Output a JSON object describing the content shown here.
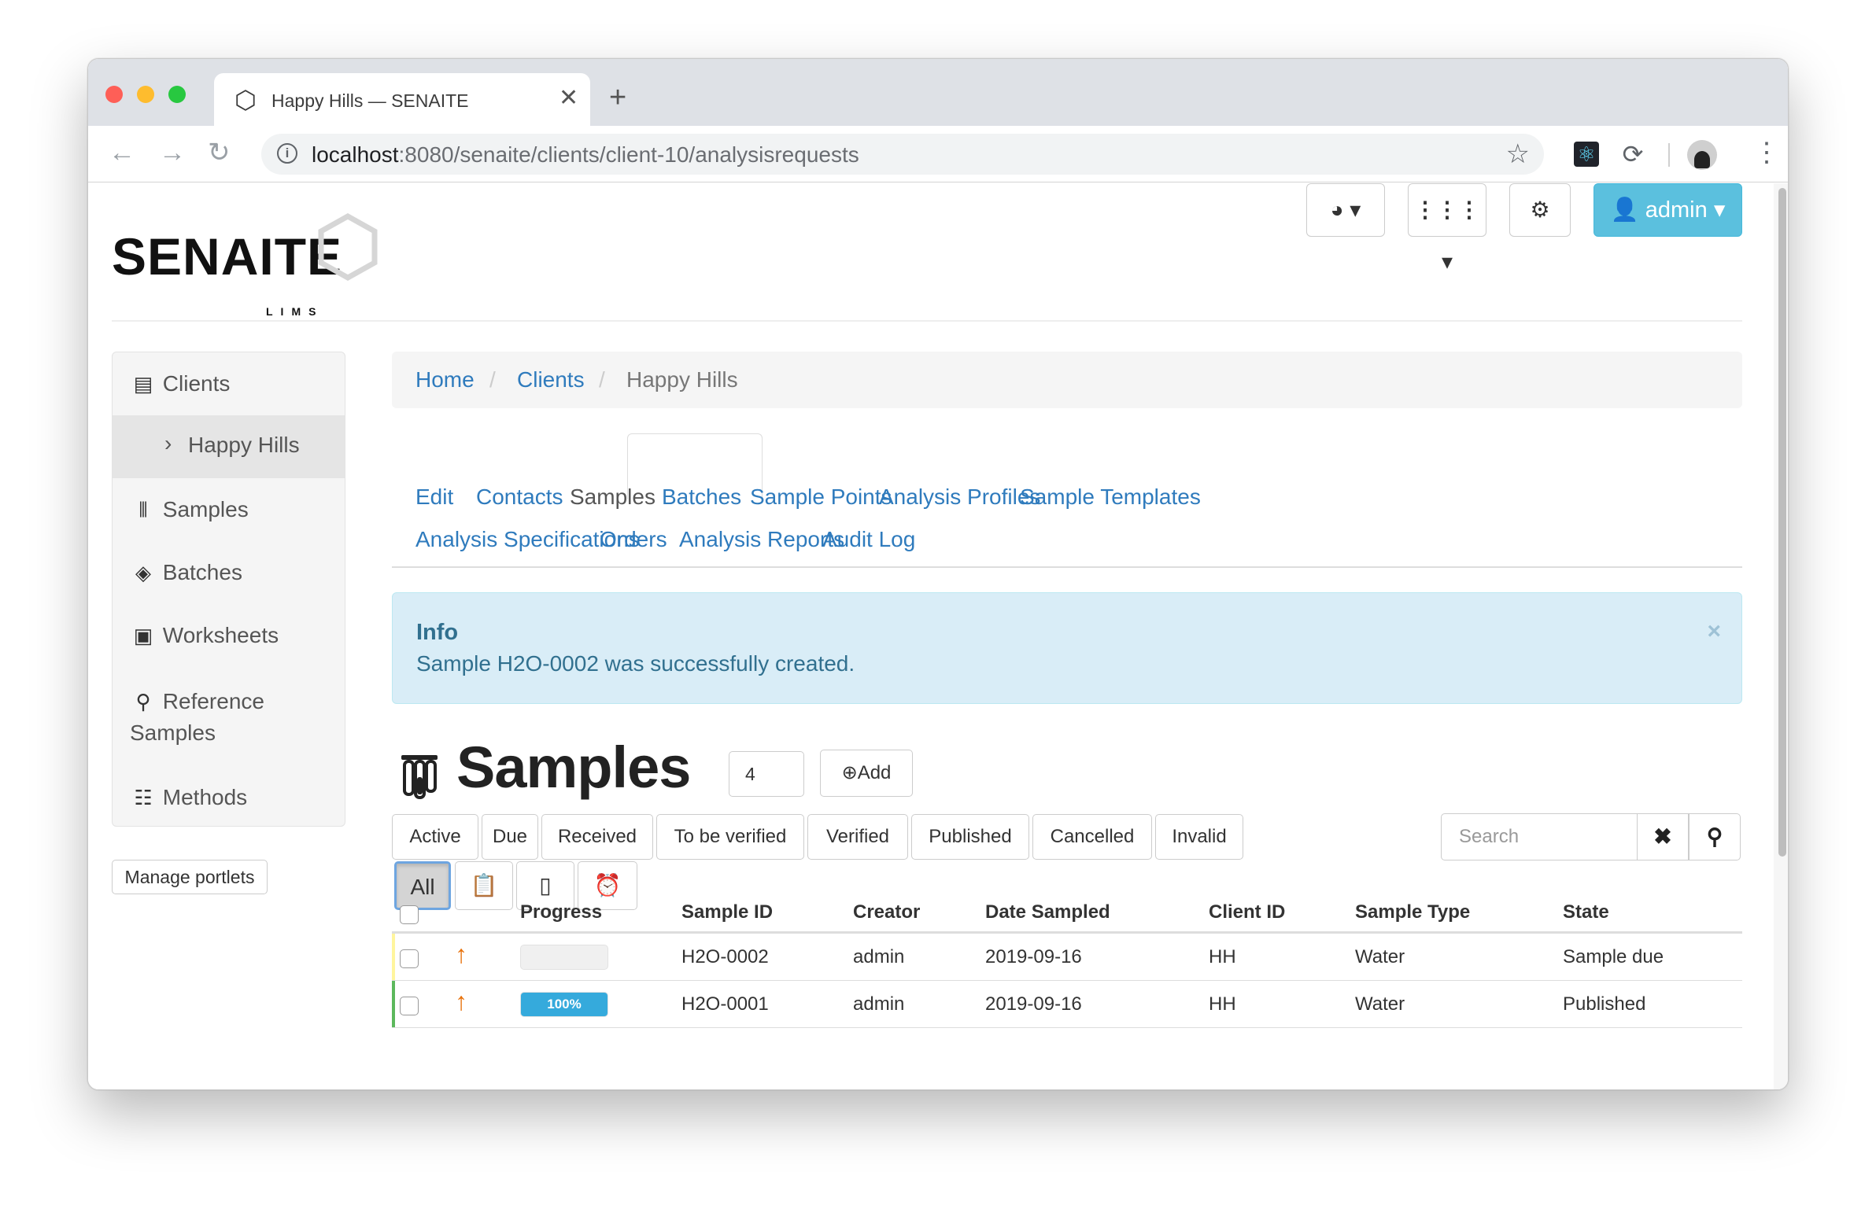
{
  "browser": {
    "tab_title": "Happy Hills — SENAITE",
    "url_host": "localhost",
    "url_rest": ":8080/senaite/clients/client-10/analysisrequests"
  },
  "header": {
    "logo_text": "SENAITE",
    "logo_sub": "LIMS",
    "admin_label": "admin"
  },
  "sidebar": {
    "items": [
      {
        "label": "Clients",
        "icon": "id-card-icon"
      },
      {
        "label": "Happy Hills",
        "icon": "chevron-right-icon"
      },
      {
        "label": "Samples",
        "icon": "test-tubes-icon"
      },
      {
        "label": "Batches",
        "icon": "layers-icon"
      },
      {
        "label": "Worksheets",
        "icon": "clipboard-clock-icon"
      },
      {
        "label": "Reference",
        "label2": "Samples",
        "icon": "reference-icon"
      },
      {
        "label": "Methods",
        "icon": "checklist-icon"
      }
    ],
    "manage_label": "Manage portlets"
  },
  "breadcrumb": {
    "home": "Home",
    "clients": "Clients",
    "current": "Happy Hills"
  },
  "tabs": [
    "Edit",
    "Contacts",
    "Samples",
    "Batches",
    "Sample Points",
    "Analysis Profiles",
    "Sample Templates",
    "Analysis Specifications",
    "Orders",
    "Analysis Reports",
    "Audit Log"
  ],
  "active_tab": "Samples",
  "alert": {
    "heading": "Info",
    "message": "Sample H2O-0002 was successfully created.",
    "close": "×"
  },
  "samples": {
    "title": "Samples",
    "count": "4",
    "add_label": "Add",
    "filters": [
      "Active",
      "Due",
      "Received",
      "To be verified",
      "Verified",
      "Published",
      "Cancelled",
      "Invalid"
    ],
    "all_label": "All",
    "search_placeholder": "Search",
    "columns": [
      "Progress",
      "Sample ID",
      "Creator",
      "Date Sampled",
      "Client ID",
      "Sample Type",
      "State"
    ],
    "rows": [
      {
        "progress": 0,
        "progress_label": "",
        "id": "H2O-0002",
        "creator": "admin",
        "date": "2019-09-16",
        "client": "HH",
        "type": "Water",
        "state": "Sample due",
        "state_color": "#fff59d"
      },
      {
        "progress": 100,
        "progress_label": "100%",
        "id": "H2O-0001",
        "creator": "admin",
        "date": "2019-09-16",
        "client": "HH",
        "type": "Water",
        "state": "Published",
        "state_color": "#5cb85c"
      }
    ]
  }
}
